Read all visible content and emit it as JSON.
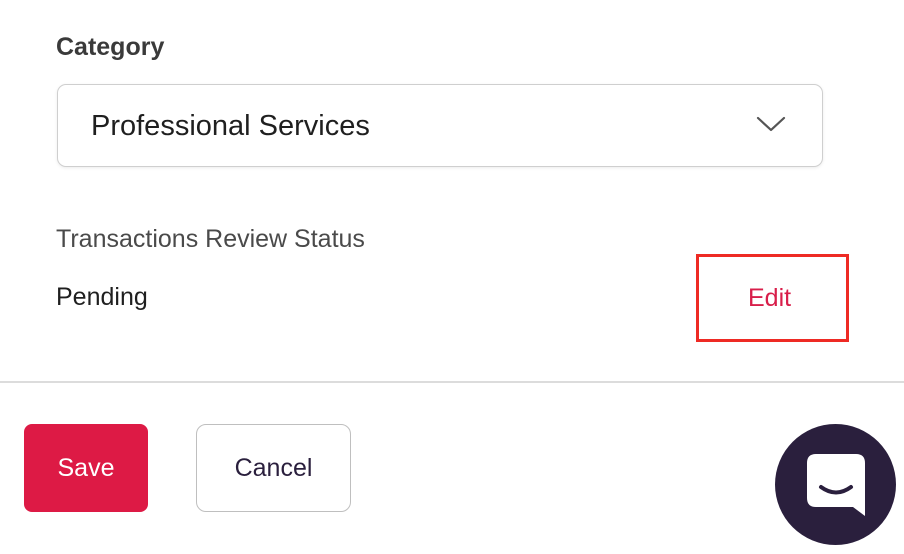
{
  "category": {
    "label": "Category",
    "selected_value": "Professional Services",
    "icon": "chevron-down-icon"
  },
  "review": {
    "label": "Transactions Review Status",
    "status": "Pending",
    "edit_label": "Edit"
  },
  "actions": {
    "save_label": "Save",
    "cancel_label": "Cancel"
  },
  "chat": {
    "icon": "chat-bubble-icon"
  },
  "colors": {
    "accent": "#dd1a45",
    "edit_link": "#d81e4a",
    "highlight_box": "#ee2a24",
    "chat_bg": "#2a1f3d"
  }
}
